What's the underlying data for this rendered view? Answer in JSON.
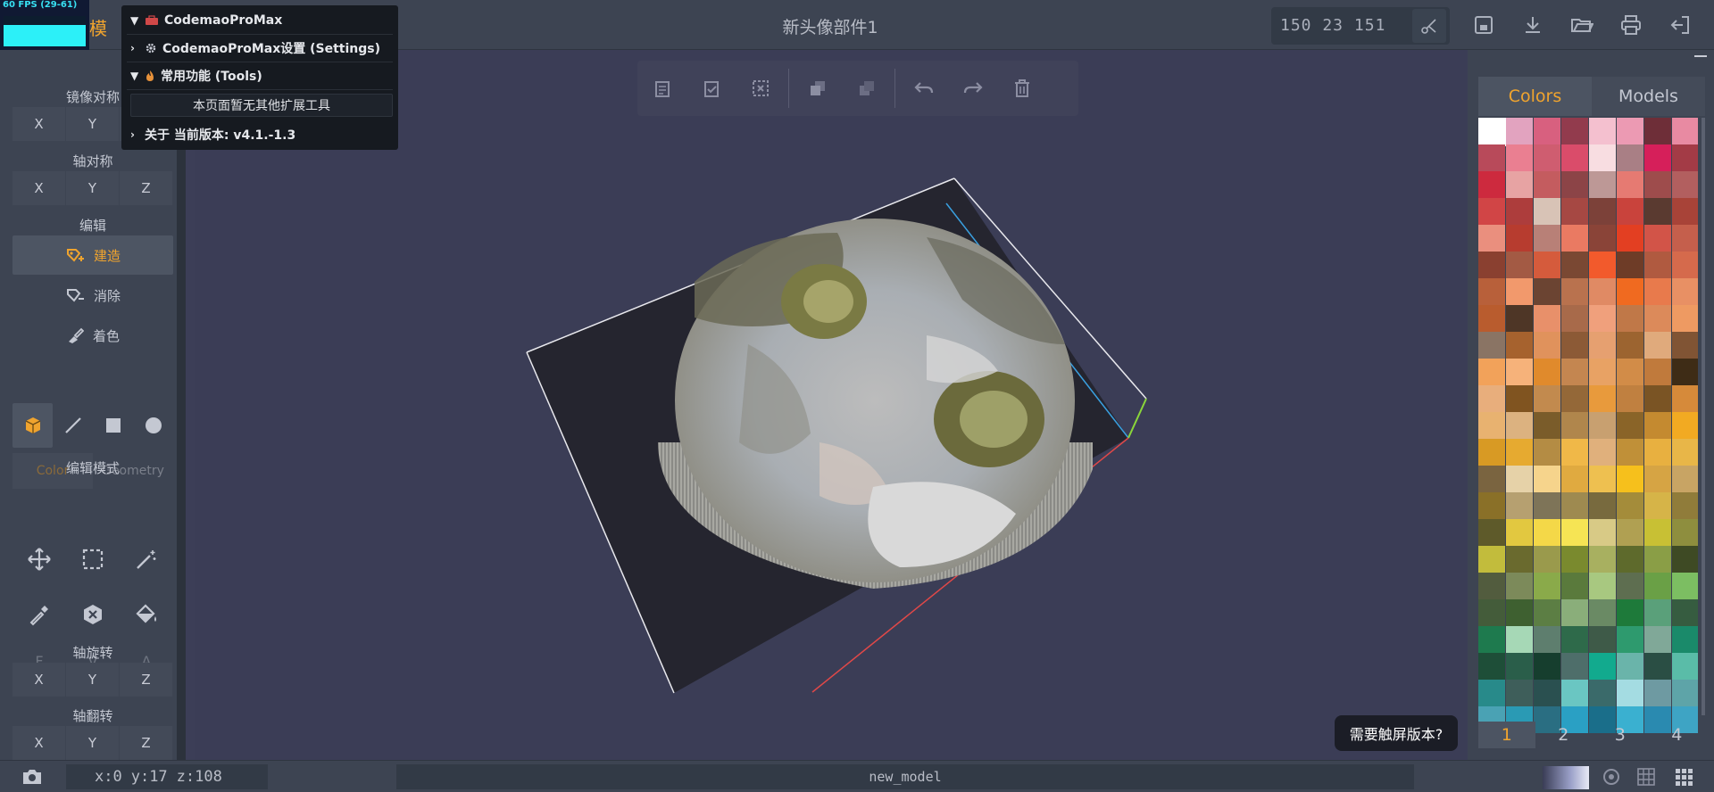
{
  "fps": {
    "label": "60 FPS (29-61)",
    "level": 0.72
  },
  "header": {
    "left_label": "模",
    "title": "新头像部件1",
    "dimensions": "150 23 151"
  },
  "menu": {
    "items": [
      {
        "label": "CodemaoProMax",
        "chevron": "down",
        "icon": "toolbox-icon"
      },
      {
        "label": "CodemaoProMax设置 (Settings)",
        "chevron": "right",
        "icon": "gear-icon"
      },
      {
        "label": "常用功能 (Tools)",
        "chevron": "down",
        "icon": "flame-icon"
      }
    ],
    "note": "本页面暂无其他扩展工具",
    "about": "关于 当前版本: v4.1.-1.3"
  },
  "left": {
    "mirror_label": "镜像对称",
    "mirror_axes": [
      "X",
      "Y"
    ],
    "axis_sym_label": "轴对称",
    "axis_sym_axes": [
      "X",
      "Y",
      "Z"
    ],
    "edit_label": "编辑",
    "build_label": "建造",
    "erase_label": "消除",
    "paint_label": "着色",
    "color_tab": "Color",
    "geometry_tab": "Geometry",
    "edit_mode_label": "编辑模式",
    "fva": [
      "F",
      "V",
      "A"
    ],
    "rotate_label": "轴旋转",
    "rotate_axes": [
      "X",
      "Y",
      "Z"
    ],
    "flip_label": "轴翻转",
    "flip_axes": [
      "X",
      "Y",
      "Z"
    ]
  },
  "touch_button": "需要触屏版本?",
  "right": {
    "tabs": [
      "Colors",
      "Models"
    ],
    "active_tab": 0,
    "pages": [
      "1",
      "2",
      "3",
      "4"
    ],
    "active_page": 0,
    "palette": [
      "#ffffff",
      "#e2a3bf",
      "#d8607f",
      "#923b4d",
      "#f4c0cf",
      "#ec9ab3",
      "#6e2e38",
      "#e88aa2",
      "#b84a5a",
      "#ea7f91",
      "#cf5d70",
      "#da4c6a",
      "#f8dde1",
      "#a97f85",
      "#d61f5a",
      "#a33b46",
      "#cd2a3e",
      "#e7a3a3",
      "#c45c5f",
      "#8c4447",
      "#bd9896",
      "#e67a72",
      "#9e4c4c",
      "#b25f5f",
      "#d14546",
      "#ad3d3c",
      "#d8c3b6",
      "#a64843",
      "#7c4139",
      "#c9433c",
      "#5a3a30",
      "#a84338",
      "#ea8f7e",
      "#b73c2f",
      "#b88077",
      "#ea7a62",
      "#8a4438",
      "#e33f22",
      "#d25448",
      "#c55f4c",
      "#8a4030",
      "#a35a44",
      "#d55b3c",
      "#7a4833",
      "#f25a2c",
      "#6e3c27",
      "#b05a40",
      "#d56a4c",
      "#b8603a",
      "#f2996c",
      "#6b4432",
      "#b9724e",
      "#e08a64",
      "#f06a20",
      "#e87a4c",
      "#e89064",
      "#b95c2e",
      "#4e3626",
      "#e8906a",
      "#a86a4a",
      "#f0a07c",
      "#c07848",
      "#dc8a5a",
      "#ee9a62",
      "#8a7464",
      "#a6622e",
      "#e0925c",
      "#8c5a36",
      "#e6a070",
      "#9c6430",
      "#e0aa7c",
      "#805434",
      "#f2a25a",
      "#f6b27a",
      "#e08a2c",
      "#c48650",
      "#e8a264",
      "#d28c48",
      "#c07a3c",
      "#3e2c16",
      "#e8ae7c",
      "#805420",
      "#c28a4e",
      "#946838",
      "#e89a3c",
      "#c08040",
      "#7a5424",
      "#d68a3a",
      "#e8b270",
      "#dcb280",
      "#7a5c2a",
      "#b0864c",
      "#c8a070",
      "#8a6428",
      "#c48a30",
      "#f2aa22",
      "#d89a24",
      "#e6aa30",
      "#b48c44",
      "#f0b848",
      "#e0b07c",
      "#c09038",
      "#e8b040",
      "#e8b648",
      "#7a6440",
      "#e6d2a8",
      "#f6d48c",
      "#e0aa40",
      "#eec050",
      "#f6c01c",
      "#d6a444",
      "#c8a464",
      "#8a7028",
      "#b6a070",
      "#7e7458",
      "#9e8a50",
      "#786a3e",
      "#a48c3a",
      "#d6b448",
      "#907c3a",
      "#5e5a2a",
      "#e2c840",
      "#f4d848",
      "#f6e454",
      "#d8ca86",
      "#b0a052",
      "#c8c034",
      "#8e8e3e",
      "#c2bc3c",
      "#6a6a2e",
      "#9a9a4c",
      "#7a8a2e",
      "#a8b060",
      "#5e6a2c",
      "#8a9e46",
      "#3e4a24",
      "#525c3e",
      "#7c8a5a",
      "#8aaa4a",
      "#5a7a3c",
      "#a8c880",
      "#5e6e50",
      "#6aa046",
      "#7cbe62",
      "#445c3a",
      "#3e6030",
      "#5c7e44",
      "#8aae7a",
      "#6a8a64",
      "#1e7a3a",
      "#5aa07a",
      "#365c40",
      "#1e7a4e",
      "#a6d8b6",
      "#5e7e6e",
      "#2e6a4a",
      "#3e5a48",
      "#2e9a6e",
      "#80a898",
      "#1a8a6a",
      "#1e4e38",
      "#2a5e4a",
      "#163e2e",
      "#4e6e6a",
      "#12aa8e",
      "#6ab4aa",
      "#2a4e44",
      "#5abca8",
      "#288a8a",
      "#3e5e5a",
      "#2a5050",
      "#6ac6c2",
      "#3a6a6a",
      "#a4dce2",
      "#6e9aa2",
      "#5ea4a8",
      "#4aa2b4",
      "#2a9ab4",
      "#2a6e82",
      "#2aa0c4",
      "#1a6e8a",
      "#3ab0d0",
      "#2a8ab0",
      "#3ea4c4"
    ]
  },
  "status": {
    "coords": [
      "x:0",
      "y:17",
      "z:108"
    ],
    "model_name": "new_model"
  }
}
